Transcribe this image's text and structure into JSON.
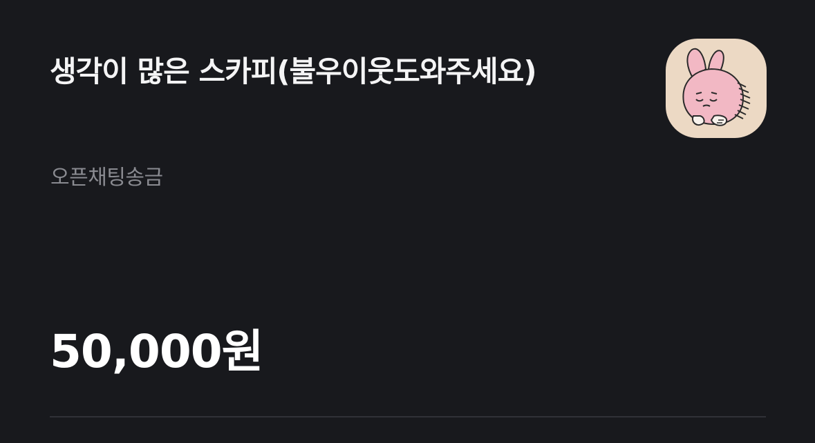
{
  "transfer": {
    "title": "생각이 많은 스카피(불우이웃도와주세요)",
    "subtitle": "오픈채팅송금",
    "amount": "50,000원"
  },
  "avatar": {
    "icon": "bunny-character-icon",
    "background": "#ecd9c4"
  },
  "colors": {
    "background": "#18191d",
    "title": "#f4f4f5",
    "subtitle": "#8a8b91",
    "divider": "#303137"
  }
}
